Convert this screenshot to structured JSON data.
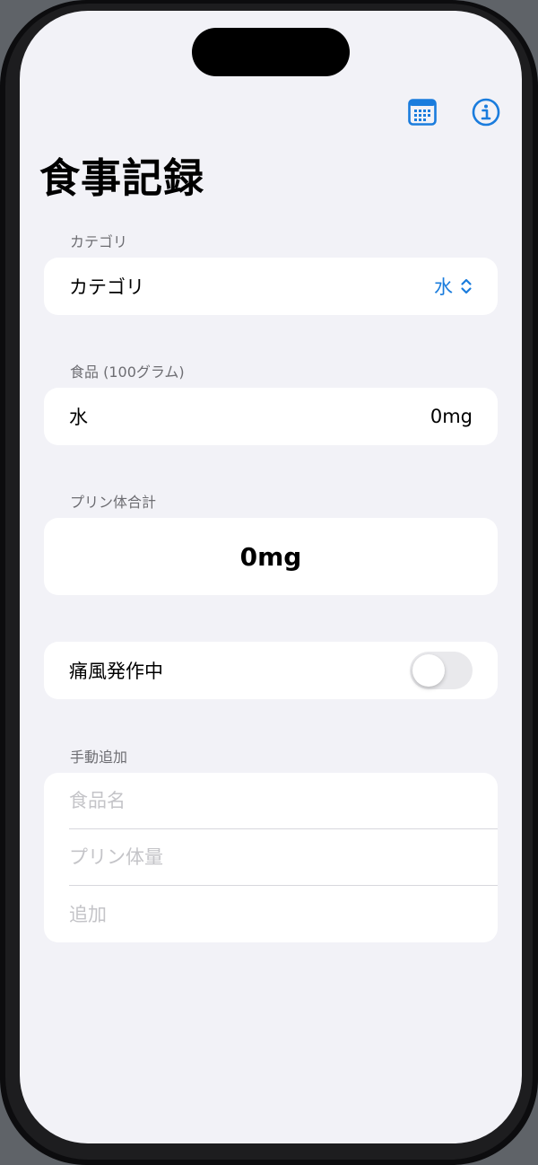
{
  "nav": {
    "title": "食事記録",
    "icons": {
      "calendar": "calendar-icon",
      "info": "info-circle-icon"
    }
  },
  "accent_color": "#1a7cdd",
  "category_section": {
    "header": "カテゴリ",
    "label": "カテゴリ",
    "selected_value": "水",
    "icon": "chevron-updown-icon"
  },
  "food_section": {
    "header": "食品 (100グラム)",
    "item_name": "水",
    "item_value": "0mg"
  },
  "total_section": {
    "header": "プリン体合計",
    "value": "0mg"
  },
  "gout_section": {
    "label": "痛風発作中",
    "toggle_on": false
  },
  "manual_section": {
    "header": "手動追加",
    "food_name_placeholder": "食品名",
    "purine_placeholder": "プリン体量",
    "add_placeholder": "追加"
  }
}
